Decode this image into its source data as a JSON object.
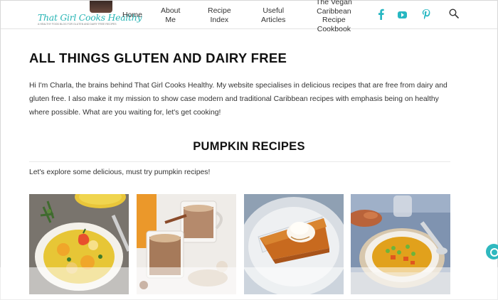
{
  "header": {
    "logo": {
      "text": "That Girl Cooks Healthy",
      "tagline": "A HEALTHY FOOD BLOG FOR GLUTEN AND DAIRY FREE RECIPES"
    },
    "nav": [
      {
        "label_lines": [
          "Home"
        ]
      },
      {
        "label_lines": [
          "About",
          "Me"
        ]
      },
      {
        "label_lines": [
          "Recipe",
          "Index"
        ]
      },
      {
        "label_lines": [
          "Useful",
          "Articles"
        ]
      },
      {
        "label_lines": [
          "The Vegan",
          "Caribbean",
          "Recipe",
          "Cookbook"
        ]
      }
    ],
    "social": [
      "facebook-icon",
      "youtube-icon",
      "pinterest-icon"
    ],
    "accent": "#27b7c2"
  },
  "main": {
    "title": "ALL THINGS GLUTEN AND DAIRY FREE",
    "intro": "Hi I'm Charla, the brains behind That Girl Cooks Healthy. My website specialises in delicious recipes that are free from dairy and gluten free. I also make it my mission to show case modern and traditional Caribbean recipes with emphasis being on healthy where possible. What are you waiting for, let's get cooking!",
    "section_title": "PUMPKIN RECIPES",
    "section_subtitle": "Let's explore some delicious, must try pumpkin recipes!",
    "cards": [
      {
        "image": "pumpkin-soup-with-pepper"
      },
      {
        "image": "pumpkin-spice-latte"
      },
      {
        "image": "pumpkin-pie-slice"
      },
      {
        "image": "pumpkin-pea-soup"
      }
    ]
  }
}
